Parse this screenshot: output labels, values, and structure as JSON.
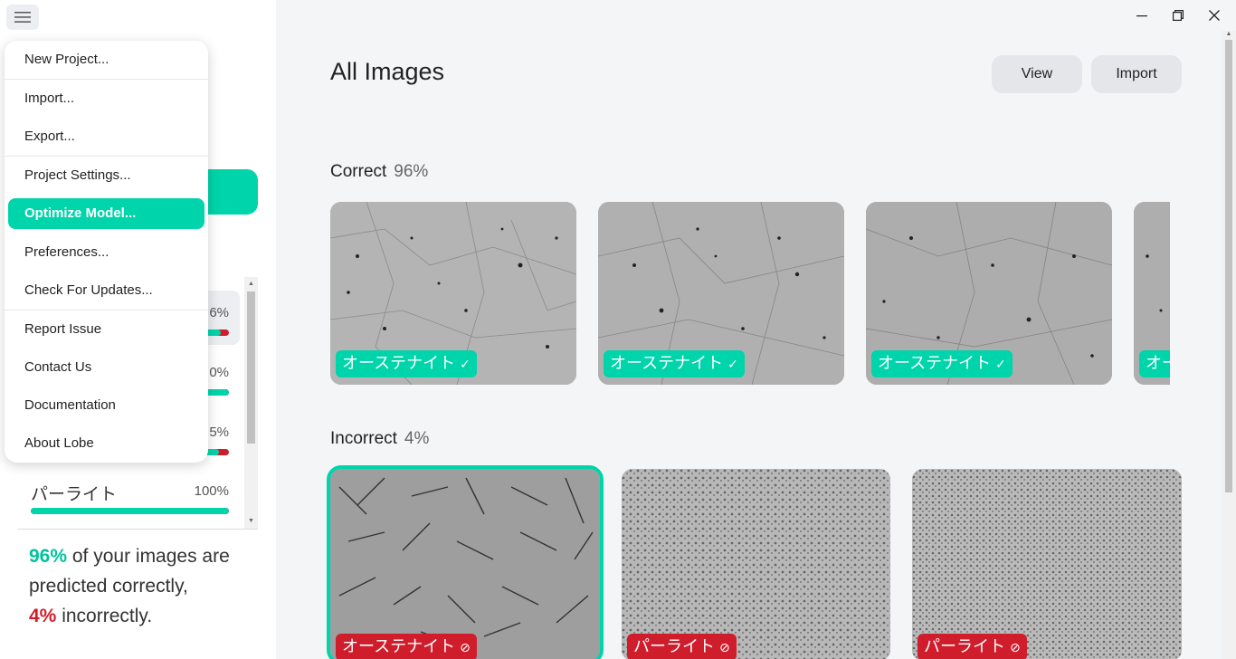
{
  "window": {
    "controls": {
      "minimize": "—",
      "restore": "❐",
      "close": "✕"
    }
  },
  "menu": {
    "items": [
      {
        "label": "New Project..."
      },
      {
        "label": "Import..."
      },
      {
        "label": "Export..."
      },
      {
        "label": "Project Settings..."
      },
      {
        "label": "Optimize Model...",
        "active": true
      },
      {
        "label": "Preferences..."
      },
      {
        "label": "Check For Updates..."
      },
      {
        "label": "Report Issue"
      },
      {
        "label": "Contact Us"
      },
      {
        "label": "Documentation"
      },
      {
        "label": "About Lobe"
      }
    ]
  },
  "sidebar": {
    "labels": [
      {
        "pct": "6%",
        "accuracy": 0.96
      },
      {
        "pct": "0%",
        "accuracy": 1.0
      },
      {
        "pct": "5%",
        "accuracy": 0.95
      },
      {
        "name": "パーライト",
        "pct": "100%",
        "accuracy": 1.0
      }
    ],
    "summary": {
      "correct_pct": "96%",
      "text1": " of your images are predicted correctly,",
      "incorrect_pct": "4%",
      "text2": " incorrectly."
    }
  },
  "main": {
    "title": "All Images",
    "buttons": {
      "view": "View",
      "import": "Import"
    },
    "sections": {
      "correct": {
        "title": "Correct",
        "pct": "96%"
      },
      "incorrect": {
        "title": "Incorrect",
        "pct": "4%"
      }
    },
    "correct_images": [
      {
        "tag": "オーステナイト",
        "icon": "✓"
      },
      {
        "tag": "オーステナイト",
        "icon": "✓"
      },
      {
        "tag": "オーステナイト",
        "icon": "✓"
      },
      {
        "tag": "オー",
        "icon": ""
      }
    ],
    "incorrect_images": [
      {
        "tag": "オーステナイト",
        "icon": "⊘"
      },
      {
        "tag": "パーライト",
        "icon": "⊘"
      },
      {
        "tag": "パーライト",
        "icon": "⊘"
      }
    ]
  },
  "colors": {
    "accent": "#00d4aa",
    "error": "#cf1d2c"
  }
}
